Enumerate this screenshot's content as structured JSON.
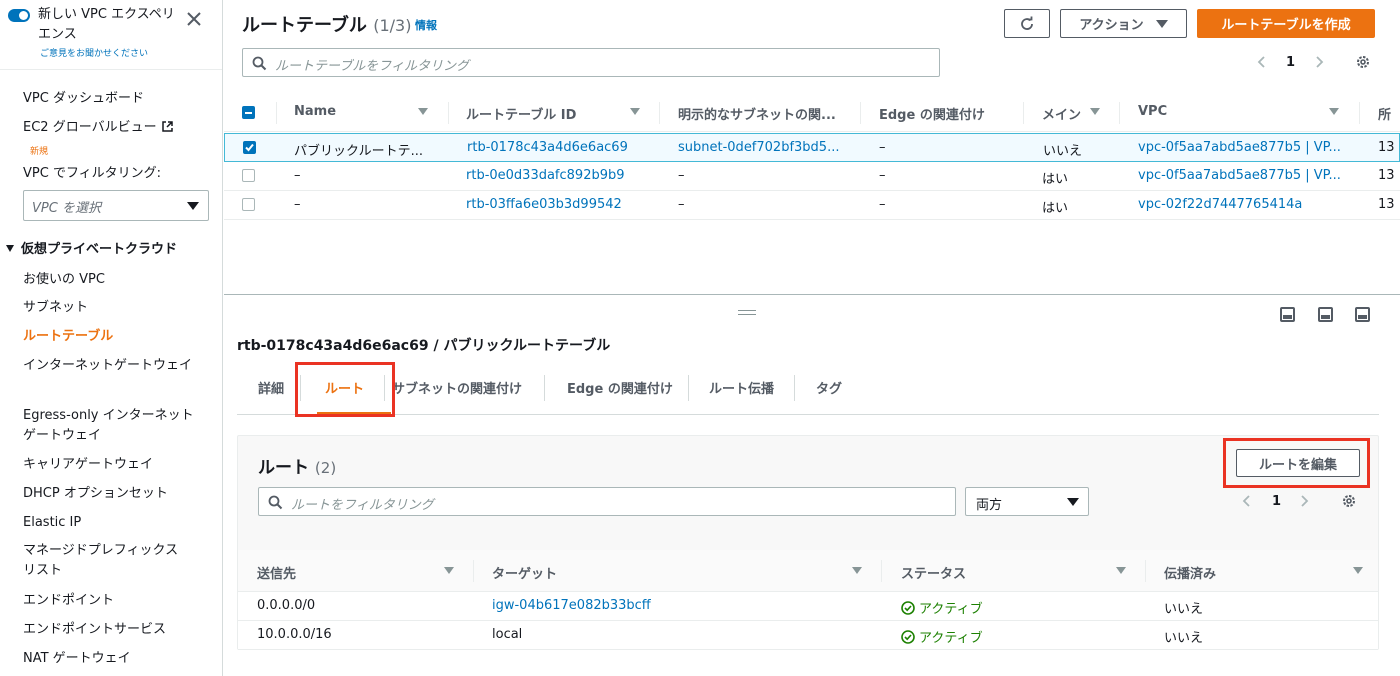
{
  "sidebar": {
    "experience_title": "新しい VPC エクスペリエンス",
    "experience_feedback": "ご意見をお聞かせください",
    "items": [
      {
        "label": "VPC ダッシュボード"
      },
      {
        "label": "EC2 グローバルビュー"
      },
      {
        "label": "VPC でフィルタリング:"
      }
    ],
    "new_badge": "新規",
    "vpc_select_placeholder": "VPC を選択",
    "section_title": "仮想プライベートクラウド",
    "nav": [
      {
        "label": "お使いの VPC"
      },
      {
        "label": "サブネット"
      },
      {
        "label": "ルートテーブル"
      },
      {
        "label": "インターネットゲートウェイ"
      },
      {
        "label": "Egress-only インターネットゲートウェイ"
      },
      {
        "label": "キャリアゲートウェイ"
      },
      {
        "label": "DHCP オプションセット"
      },
      {
        "label": "Elastic IP"
      },
      {
        "label": "マネージドプレフィックスリスト"
      },
      {
        "label": "エンドポイント"
      },
      {
        "label": "エンドポイントサービス"
      },
      {
        "label": "NAT ゲートウェイ"
      }
    ]
  },
  "header": {
    "title": "ルートテーブル",
    "count": "(1/3)",
    "info": "情報",
    "actions_label": "アクション",
    "create_label": "ルートテーブルを作成",
    "filter_placeholder": "ルートテーブルをフィルタリング",
    "page": "1"
  },
  "route_tables": {
    "columns": [
      "Name",
      "ルートテーブル ID",
      "明示的なサブネットの関...",
      "Edge の関連付け",
      "メイン",
      "VPC",
      "所"
    ],
    "rows": [
      {
        "name": "パブリックルートテ...",
        "id": "rtb-0178c43a4d6e6ac69",
        "subnet": "subnet-0def702bf3bd5...",
        "edge": "–",
        "main": "いいえ",
        "vpc": "vpc-0f5aa7abd5ae877b5 | VP...",
        "owner": "13"
      },
      {
        "name": "–",
        "id": "rtb-0e0d33dafc892b9b9",
        "subnet": "–",
        "edge": "–",
        "main": "はい",
        "vpc": "vpc-0f5aa7abd5ae877b5 | VP...",
        "owner": "13"
      },
      {
        "name": "–",
        "id": "rtb-03ffa6e03b3d99542",
        "subnet": "–",
        "edge": "–",
        "main": "はい",
        "vpc": "vpc-02f22d7447765414a",
        "owner": "13"
      }
    ]
  },
  "detail": {
    "title": "rtb-0178c43a4d6e6ac69 / パブリックルートテーブル",
    "tabs": [
      "詳細",
      "ルート",
      "サブネットの関連付け",
      "Edge の関連付け",
      "ルート伝播",
      "タグ"
    ],
    "active_tab": "ルート",
    "routes_title": "ルート",
    "routes_count": "(2)",
    "edit_label": "ルートを編集",
    "filter_placeholder": "ルートをフィルタリング",
    "direction": "両方",
    "page": "1",
    "columns": [
      "送信先",
      "ターゲット",
      "ステータス",
      "伝播済み"
    ],
    "rows": [
      {
        "dest": "0.0.0.0/0",
        "target": "igw-04b617e082b33bcff",
        "status": "アクティブ",
        "propagated": "いいえ"
      },
      {
        "dest": "10.0.0.0/16",
        "target": "local",
        "status": "アクティブ",
        "propagated": "いいえ"
      }
    ]
  },
  "colors": {
    "accent": "#ec7211",
    "link": "#0073bb",
    "success": "#1d8102",
    "highlight": "#ea3323"
  }
}
